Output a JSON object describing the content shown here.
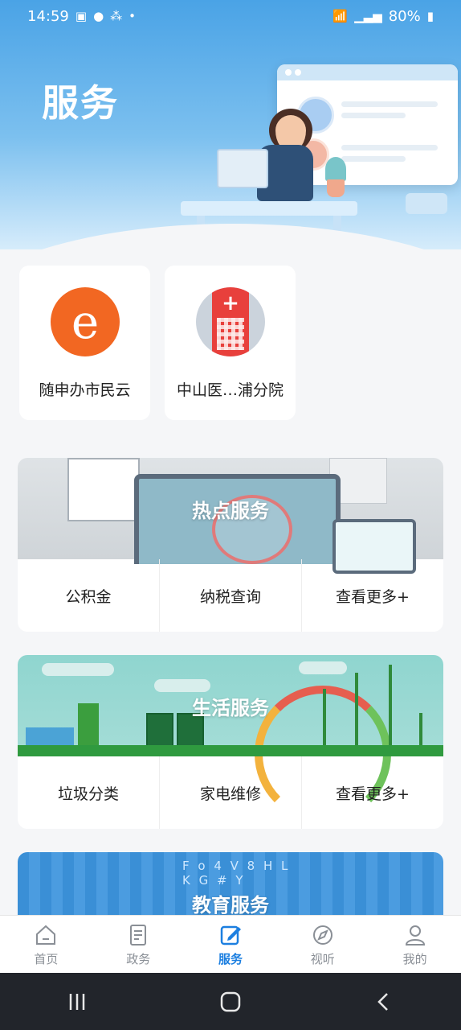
{
  "status_bar": {
    "time": "14:59",
    "battery": "80%"
  },
  "header": {
    "title": "服务"
  },
  "apps": [
    {
      "label": "随申办市民云",
      "icon": "e-logo-icon"
    },
    {
      "label": "中山医…浦分院",
      "icon": "hospital-icon"
    }
  ],
  "sections": {
    "hot": {
      "title": "热点服务",
      "items": [
        "公积金",
        "纳税查询",
        "查看更多+"
      ]
    },
    "life": {
      "title": "生活服务",
      "items": [
        "垃圾分类",
        "家电维修",
        "查看更多+"
      ]
    },
    "edu": {
      "title": "教育服务",
      "letters": "F o 4 V 8 H L K G # Y"
    }
  },
  "bottom_nav": [
    {
      "label": "首页",
      "icon": "home-icon",
      "active": false
    },
    {
      "label": "政务",
      "icon": "document-icon",
      "active": false
    },
    {
      "label": "服务",
      "icon": "edit-icon",
      "active": true
    },
    {
      "label": "视听",
      "icon": "compass-icon",
      "active": false
    },
    {
      "label": "我的",
      "icon": "user-icon",
      "active": false
    }
  ],
  "colors": {
    "accent": "#1c7fe0",
    "inactive": "#8a8f96",
    "header_blue": "#4aa3e6"
  }
}
